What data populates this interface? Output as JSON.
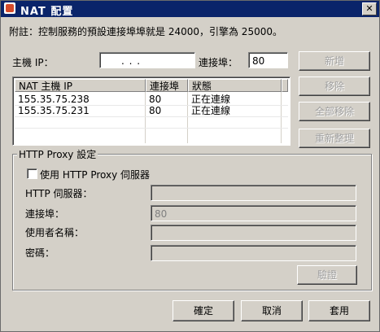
{
  "title": "NAT 配置",
  "note": "附註：控制服務的預設連接埠埠就是 24000，引擎為 25000。",
  "host_ip": {
    "label": "主機 IP：",
    "value": ".     .     ."
  },
  "port": {
    "label": "連接埠：",
    "value": "80"
  },
  "buttons": {
    "add": "新增",
    "remove": "移除",
    "remove_all": "全部移除",
    "reorganize": "重新整理",
    "verify": "驗證",
    "ok": "確定",
    "cancel": "取消",
    "apply": "套用"
  },
  "list": {
    "columns": [
      "NAT 主機 IP",
      "連接埠",
      "狀態"
    ],
    "rows": [
      {
        "ip": "155.35.75.238",
        "port": "80",
        "status": "正在連線"
      },
      {
        "ip": "155.35.75.231",
        "port": "80",
        "status": "正在連線"
      }
    ]
  },
  "proxy": {
    "group_title": "HTTP Proxy 設定",
    "use_proxy_label": "使用 HTTP Proxy 伺服器",
    "use_proxy_checked": false,
    "server_label": "HTTP 伺服器：",
    "server_value": "",
    "port_label": "連接埠：",
    "port_value": "80",
    "username_label": "使用者名稱：",
    "username_value": "",
    "password_label": "密碼：",
    "password_value": ""
  },
  "icons": {
    "title_icon": "app-icon",
    "close": "close-icon"
  }
}
